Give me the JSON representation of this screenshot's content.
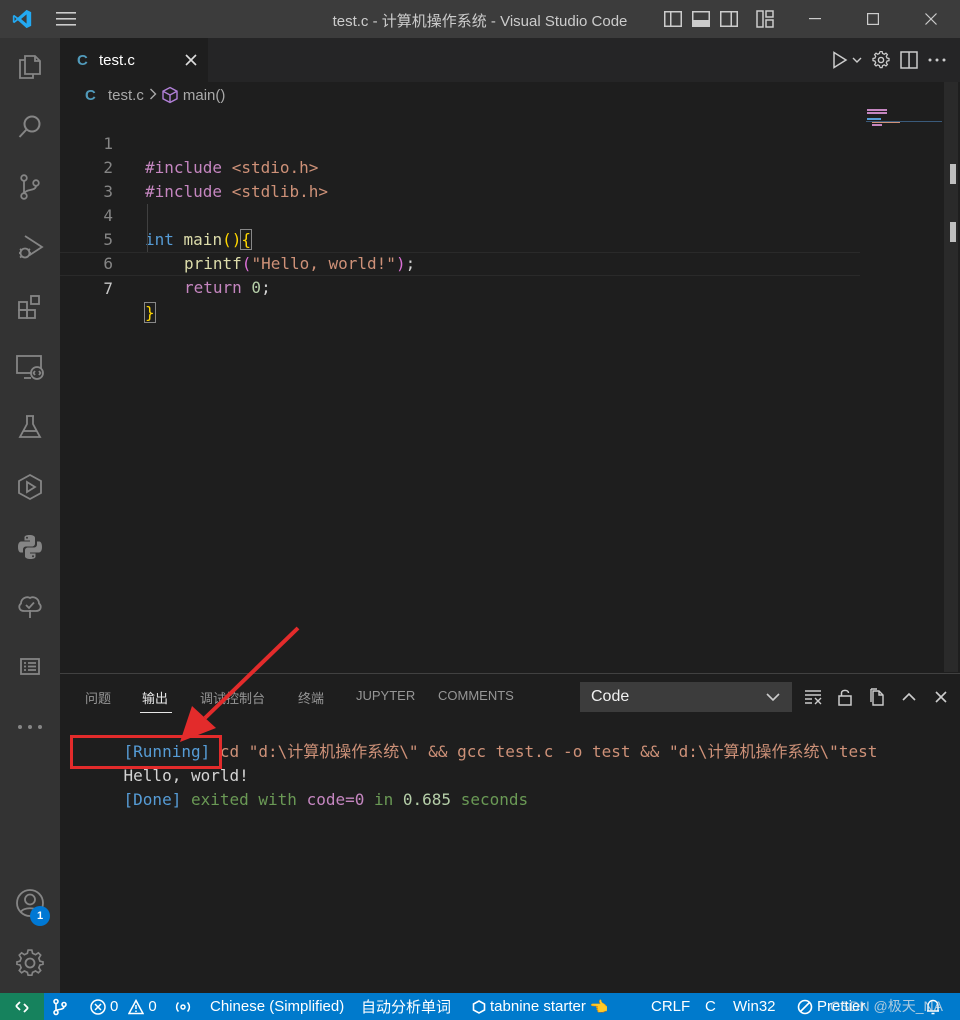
{
  "window": {
    "title": "test.c - 计算机操作系统 - Visual Studio Code"
  },
  "activity_bar": {
    "items": [
      "explorer-icon",
      "search-icon",
      "source-control-icon",
      "run-debug-icon",
      "extensions-icon",
      "remote-explorer-icon",
      "testing-icon",
      "deploy-icon",
      "python-icon",
      "tree-check-icon",
      "outline-icon",
      "more-icon"
    ],
    "accounts_badge": "1"
  },
  "editor": {
    "tab": {
      "icon_letter": "C",
      "label": "test.c"
    },
    "breadcrumb": {
      "icon_letter": "C",
      "file": "test.c",
      "symbol": "main()"
    },
    "lines": [
      {
        "num": "1",
        "text": "#include <stdio.h>"
      },
      {
        "num": "2",
        "text": "#include <stdlib.h>"
      },
      {
        "num": "3",
        "text": ""
      },
      {
        "num": "4",
        "text": "int main(){"
      },
      {
        "num": "5",
        "text": "    printf(\"Hello, world!\");"
      },
      {
        "num": "6",
        "text": "    return 0;"
      },
      {
        "num": "7",
        "text": "}"
      }
    ],
    "tokens": {
      "inc1": "#include",
      "hdr1": " <stdio.h>",
      "inc2": "#include",
      "hdr2": " <stdlib.h>",
      "int": "int",
      "main": " main",
      "paren_open": "(",
      "paren_close": ")",
      "brace_open": "{",
      "printf": "printf",
      "p_open": "(",
      "hello": "\"Hello, world!\"",
      "p_close": ")",
      "semi": ";",
      "return": "return",
      "zero": " 0",
      "semi2": ";",
      "brace_close": "}"
    }
  },
  "panel": {
    "tabs": [
      "问题",
      "输出",
      "调试控制台",
      "终端",
      "JUPYTER",
      "COMMENTS"
    ],
    "active_tab": "输出",
    "channel": "Code",
    "output": {
      "running_tag": "[Running]",
      "running_cmd": " cd \"d:\\计算机操作系统\\\" && gcc test.c -o test && \"d:\\计算机操作系统\\\"test",
      "program_output": "Hello, world!",
      "done_tag": "[Done]",
      "done_exited": " exited with ",
      "done_code": "code=0",
      "done_in": " in ",
      "done_time": "0.685",
      "done_seconds": " seconds"
    }
  },
  "status_bar": {
    "errors": "0",
    "warnings": "0",
    "language_pack": "Chinese (Simplified)",
    "word_analysis": "自动分析单词",
    "tabnine": "tabnine starter",
    "eol": "CRLF",
    "language": "C",
    "platform": "Win32",
    "prettier": "Prettier"
  },
  "watermark": "CSDN @极天_NA",
  "colors": {
    "accent": "#007acc",
    "remote": "#16825d",
    "highlight_box": "#e32b2b"
  }
}
